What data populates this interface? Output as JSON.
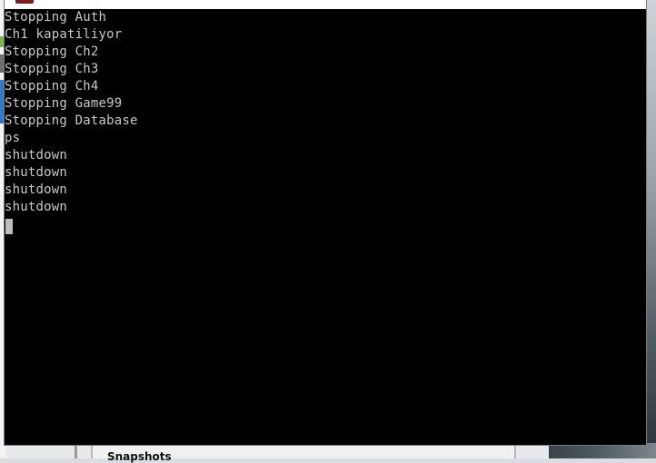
{
  "console": {
    "lines": [
      "Stopping Auth",
      "Ch1 kapatiliyor",
      "Stopping Ch2",
      "Stopping Ch3",
      "Stopping Ch4",
      "Stopping Game99",
      "Stopping Database",
      "ps",
      "shutdown",
      "shutdown",
      "shutdown",
      "shutdown"
    ]
  },
  "background": {
    "panel_label": "Snapshots"
  },
  "colors": {
    "console_bg": "#000000",
    "console_text": "#c8c8c8",
    "cursor": "#bdbdbd"
  }
}
